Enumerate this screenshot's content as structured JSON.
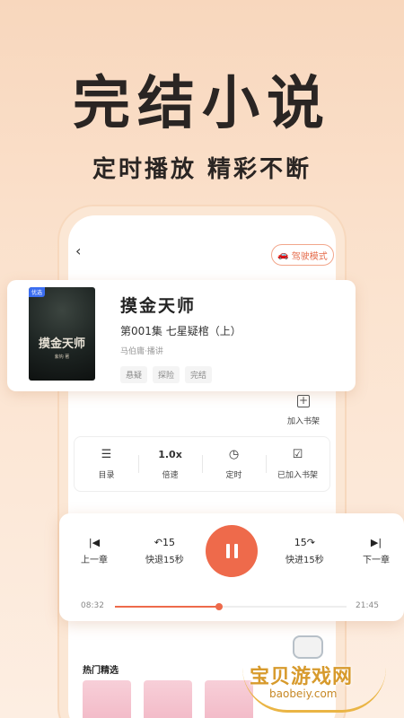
{
  "hero": {
    "title": "完结小说",
    "subtitle": "定时播放 精彩不断"
  },
  "header": {
    "back_icon": "‹",
    "drive_mode_label": "驾驶模式"
  },
  "book": {
    "cover_badge": "优选",
    "cover_title": "摸金天师",
    "cover_author": "紫钩 著",
    "title": "摸金天师",
    "chapter": "第001集  七星疑棺（上）",
    "narrator": "马伯庸·播讲",
    "tags": [
      "悬疑",
      "探险",
      "完结"
    ]
  },
  "add_shelf_label": "加入书架",
  "controls": [
    {
      "icon": "☰",
      "label": "目录"
    },
    {
      "icon": "1.0x",
      "label": "倍速"
    },
    {
      "icon": "◷",
      "label": "定时"
    },
    {
      "icon": "☑",
      "label": "已加入书架"
    }
  ],
  "player": {
    "prev_label": "上一章",
    "back15_icon": "↶15",
    "back15_label": "快退15秒",
    "fwd15_icon": "15↷",
    "fwd15_label": "快进15秒",
    "next_label": "下一章",
    "current_time": "08:32",
    "total_time": "21:45",
    "progress": 0.45
  },
  "section_title": "热门精选",
  "watermark": {
    "text": "宝贝游戏网",
    "url": "baobeiy.com"
  },
  "colors": {
    "accent": "#ee6a4b",
    "background": "#f8d7bd"
  }
}
